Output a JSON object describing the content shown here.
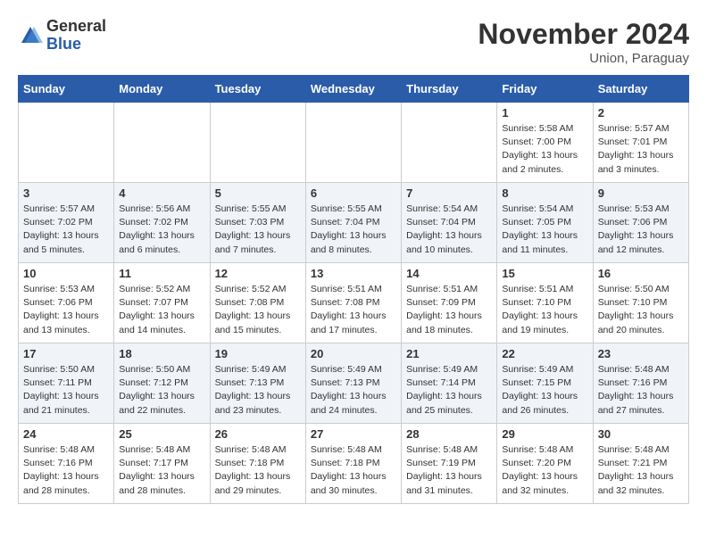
{
  "logo": {
    "general": "General",
    "blue": "Blue"
  },
  "title": "November 2024",
  "subtitle": "Union, Paraguay",
  "days_of_week": [
    "Sunday",
    "Monday",
    "Tuesday",
    "Wednesday",
    "Thursday",
    "Friday",
    "Saturday"
  ],
  "weeks": [
    [
      {
        "day": "",
        "info": ""
      },
      {
        "day": "",
        "info": ""
      },
      {
        "day": "",
        "info": ""
      },
      {
        "day": "",
        "info": ""
      },
      {
        "day": "",
        "info": ""
      },
      {
        "day": "1",
        "info": "Sunrise: 5:58 AM\nSunset: 7:00 PM\nDaylight: 13 hours and 2 minutes."
      },
      {
        "day": "2",
        "info": "Sunrise: 5:57 AM\nSunset: 7:01 PM\nDaylight: 13 hours and 3 minutes."
      }
    ],
    [
      {
        "day": "3",
        "info": "Sunrise: 5:57 AM\nSunset: 7:02 PM\nDaylight: 13 hours and 5 minutes."
      },
      {
        "day": "4",
        "info": "Sunrise: 5:56 AM\nSunset: 7:02 PM\nDaylight: 13 hours and 6 minutes."
      },
      {
        "day": "5",
        "info": "Sunrise: 5:55 AM\nSunset: 7:03 PM\nDaylight: 13 hours and 7 minutes."
      },
      {
        "day": "6",
        "info": "Sunrise: 5:55 AM\nSunset: 7:04 PM\nDaylight: 13 hours and 8 minutes."
      },
      {
        "day": "7",
        "info": "Sunrise: 5:54 AM\nSunset: 7:04 PM\nDaylight: 13 hours and 10 minutes."
      },
      {
        "day": "8",
        "info": "Sunrise: 5:54 AM\nSunset: 7:05 PM\nDaylight: 13 hours and 11 minutes."
      },
      {
        "day": "9",
        "info": "Sunrise: 5:53 AM\nSunset: 7:06 PM\nDaylight: 13 hours and 12 minutes."
      }
    ],
    [
      {
        "day": "10",
        "info": "Sunrise: 5:53 AM\nSunset: 7:06 PM\nDaylight: 13 hours and 13 minutes."
      },
      {
        "day": "11",
        "info": "Sunrise: 5:52 AM\nSunset: 7:07 PM\nDaylight: 13 hours and 14 minutes."
      },
      {
        "day": "12",
        "info": "Sunrise: 5:52 AM\nSunset: 7:08 PM\nDaylight: 13 hours and 15 minutes."
      },
      {
        "day": "13",
        "info": "Sunrise: 5:51 AM\nSunset: 7:08 PM\nDaylight: 13 hours and 17 minutes."
      },
      {
        "day": "14",
        "info": "Sunrise: 5:51 AM\nSunset: 7:09 PM\nDaylight: 13 hours and 18 minutes."
      },
      {
        "day": "15",
        "info": "Sunrise: 5:51 AM\nSunset: 7:10 PM\nDaylight: 13 hours and 19 minutes."
      },
      {
        "day": "16",
        "info": "Sunrise: 5:50 AM\nSunset: 7:10 PM\nDaylight: 13 hours and 20 minutes."
      }
    ],
    [
      {
        "day": "17",
        "info": "Sunrise: 5:50 AM\nSunset: 7:11 PM\nDaylight: 13 hours and 21 minutes."
      },
      {
        "day": "18",
        "info": "Sunrise: 5:50 AM\nSunset: 7:12 PM\nDaylight: 13 hours and 22 minutes."
      },
      {
        "day": "19",
        "info": "Sunrise: 5:49 AM\nSunset: 7:13 PM\nDaylight: 13 hours and 23 minutes."
      },
      {
        "day": "20",
        "info": "Sunrise: 5:49 AM\nSunset: 7:13 PM\nDaylight: 13 hours and 24 minutes."
      },
      {
        "day": "21",
        "info": "Sunrise: 5:49 AM\nSunset: 7:14 PM\nDaylight: 13 hours and 25 minutes."
      },
      {
        "day": "22",
        "info": "Sunrise: 5:49 AM\nSunset: 7:15 PM\nDaylight: 13 hours and 26 minutes."
      },
      {
        "day": "23",
        "info": "Sunrise: 5:48 AM\nSunset: 7:16 PM\nDaylight: 13 hours and 27 minutes."
      }
    ],
    [
      {
        "day": "24",
        "info": "Sunrise: 5:48 AM\nSunset: 7:16 PM\nDaylight: 13 hours and 28 minutes."
      },
      {
        "day": "25",
        "info": "Sunrise: 5:48 AM\nSunset: 7:17 PM\nDaylight: 13 hours and 28 minutes."
      },
      {
        "day": "26",
        "info": "Sunrise: 5:48 AM\nSunset: 7:18 PM\nDaylight: 13 hours and 29 minutes."
      },
      {
        "day": "27",
        "info": "Sunrise: 5:48 AM\nSunset: 7:18 PM\nDaylight: 13 hours and 30 minutes."
      },
      {
        "day": "28",
        "info": "Sunrise: 5:48 AM\nSunset: 7:19 PM\nDaylight: 13 hours and 31 minutes."
      },
      {
        "day": "29",
        "info": "Sunrise: 5:48 AM\nSunset: 7:20 PM\nDaylight: 13 hours and 32 minutes."
      },
      {
        "day": "30",
        "info": "Sunrise: 5:48 AM\nSunset: 7:21 PM\nDaylight: 13 hours and 32 minutes."
      }
    ]
  ]
}
